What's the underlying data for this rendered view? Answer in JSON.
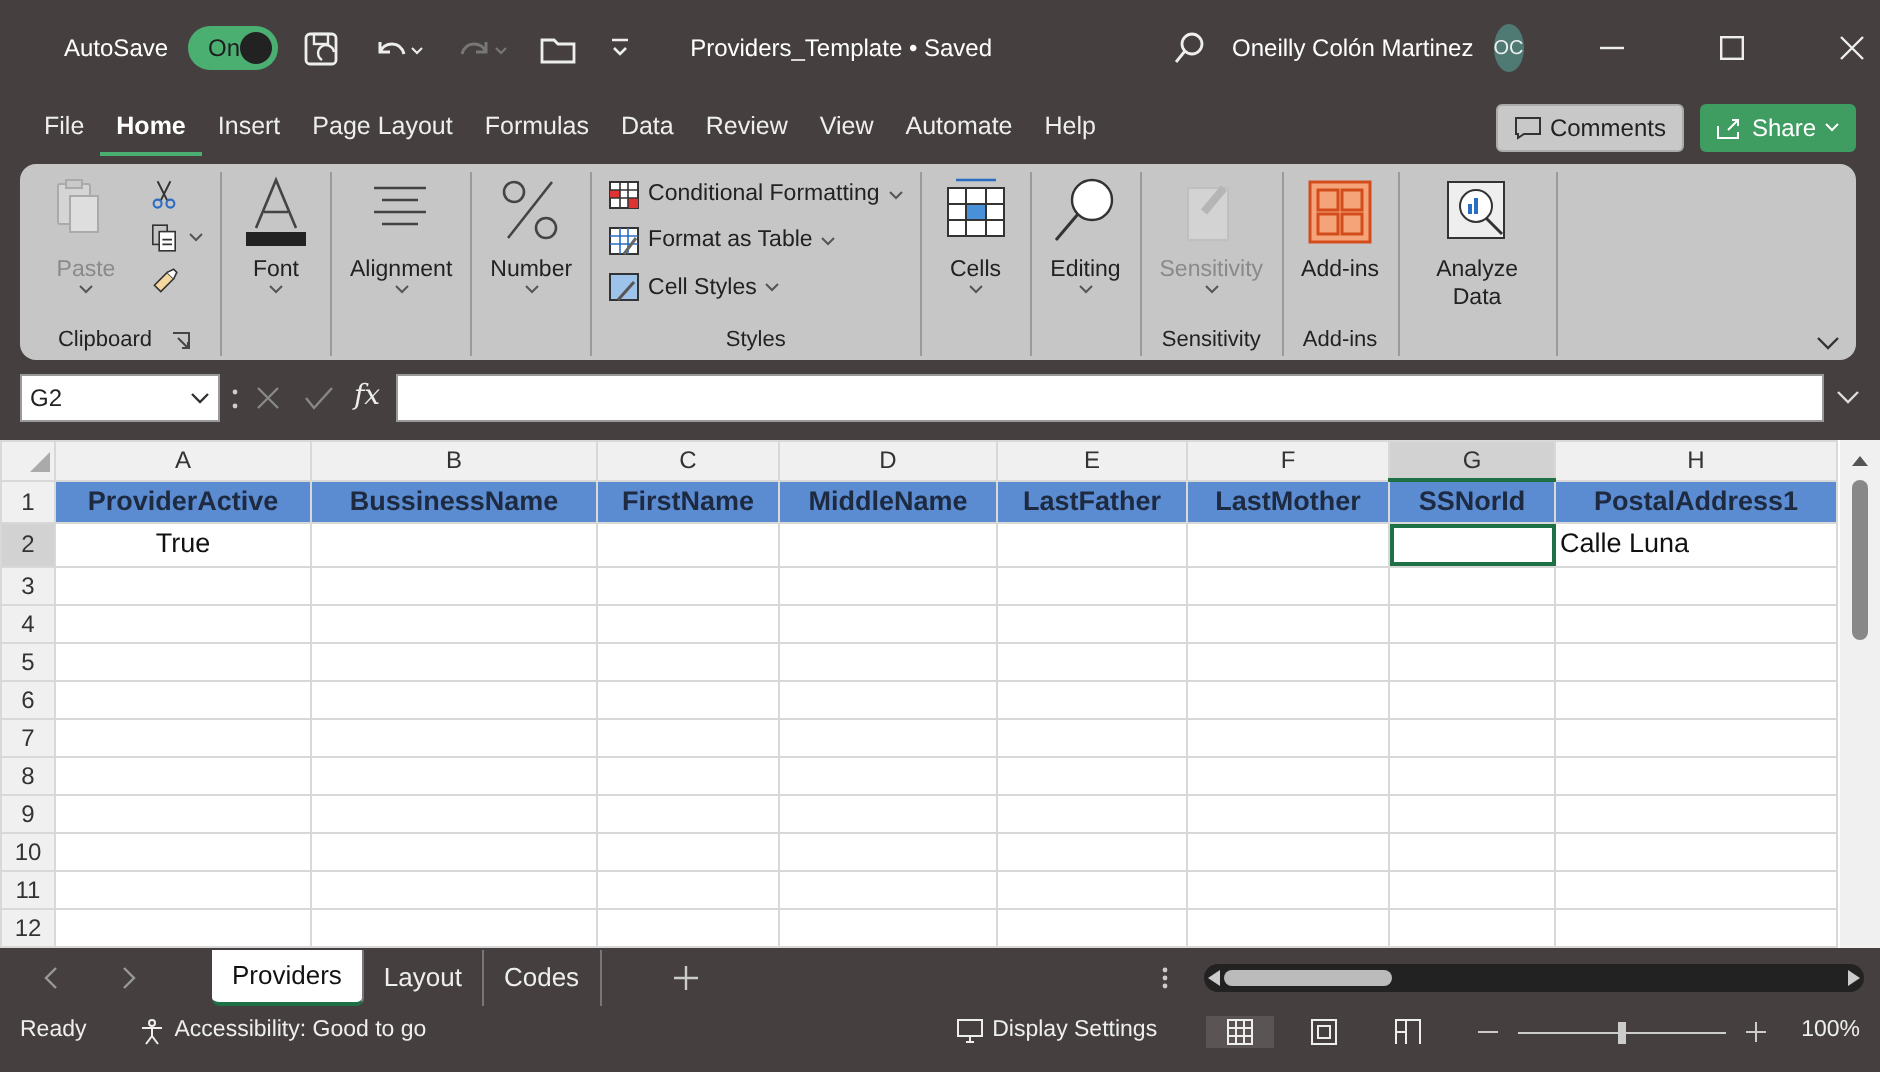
{
  "title_bar": {
    "autosave_label": "AutoSave",
    "autosave_toggle": {
      "text": "On",
      "on": true
    },
    "file_title": "Providers_Template • Saved",
    "user_name": "Oneilly Colón Martinez",
    "user_initials": "OC"
  },
  "menu_tabs": [
    {
      "label": "File",
      "selected": false
    },
    {
      "label": "Home",
      "selected": true
    },
    {
      "label": "Insert",
      "selected": false
    },
    {
      "label": "Page Layout",
      "selected": false
    },
    {
      "label": "Formulas",
      "selected": false
    },
    {
      "label": "Data",
      "selected": false
    },
    {
      "label": "Review",
      "selected": false
    },
    {
      "label": "View",
      "selected": false
    },
    {
      "label": "Automate",
      "selected": false
    },
    {
      "label": "Help",
      "selected": false
    }
  ],
  "comments_button": "Comments",
  "share_button": "Share",
  "ribbon_groups": [
    {
      "label": "Clipboard",
      "launcher": true,
      "large": [
        {
          "kind": "paste",
          "label": "Paste",
          "disabled": true,
          "dropdown": true
        }
      ],
      "small": [
        {
          "kind": "cut",
          "disabled": false,
          "dropdown": false
        },
        {
          "kind": "copy",
          "disabled": false,
          "dropdown": true
        },
        {
          "kind": "brush",
          "disabled": false,
          "dropdown": false
        }
      ]
    },
    {
      "large": [
        {
          "kind": "font",
          "label": "Font",
          "disabled": false,
          "dropdown": true
        }
      ]
    },
    {
      "large": [
        {
          "kind": "align",
          "label": "Alignment",
          "disabled": false,
          "dropdown": true
        }
      ]
    },
    {
      "large": [
        {
          "kind": "percent",
          "label": "Number",
          "disabled": false,
          "dropdown": true
        }
      ]
    },
    {
      "label": "Styles",
      "small": [
        {
          "kind": "condfmt",
          "label": "Conditional Formatting",
          "disabled": false,
          "dropdown": true
        },
        {
          "kind": "table",
          "label": "Format as Table",
          "disabled": false,
          "dropdown": true
        },
        {
          "kind": "cellstyle",
          "label": "Cell Styles",
          "disabled": false,
          "dropdown": true
        }
      ]
    },
    {
      "large": [
        {
          "kind": "cells",
          "label": "Cells",
          "disabled": false,
          "dropdown": true
        }
      ]
    },
    {
      "large": [
        {
          "kind": "search",
          "label": "Editing",
          "disabled": false,
          "dropdown": true
        }
      ]
    },
    {
      "label": "Sensitivity",
      "large": [
        {
          "kind": "sensitivity",
          "label": "Sensitivity",
          "disabled": true,
          "dropdown": true
        }
      ]
    },
    {
      "label": "Add-ins",
      "large": [
        {
          "kind": "addins",
          "label": "Add-ins",
          "disabled": false,
          "dropdown": false
        }
      ]
    },
    {
      "large": [
        {
          "kind": "analyze",
          "label": "Analyze Data",
          "disabled": false,
          "dropdown": false
        }
      ]
    }
  ],
  "formula_bar": {
    "name_box": "G2",
    "fx_label": "fx"
  },
  "columns": [
    {
      "letter": "A",
      "selected": false
    },
    {
      "letter": "B",
      "selected": false
    },
    {
      "letter": "C",
      "selected": false
    },
    {
      "letter": "D",
      "selected": false
    },
    {
      "letter": "E",
      "selected": false
    },
    {
      "letter": "F",
      "selected": false
    },
    {
      "letter": "G",
      "selected": true
    },
    {
      "letter": "H",
      "selected": false
    }
  ],
  "rows": [
    {
      "number": "1",
      "kind": "header",
      "selected": false,
      "cells": {
        "column_1": {
          "text": "ProviderActive"
        },
        "column_2": {
          "text": "BussinessName"
        },
        "column_3": {
          "text": "FirstName"
        },
        "column_4": {
          "text": "MiddleName"
        },
        "column_5": {
          "text": "LastFather"
        },
        "column_6": {
          "text": "LastMother"
        },
        "column_7": {
          "text": "SSNorId"
        },
        "column_8": {
          "text": "PostalAddress1"
        }
      }
    },
    {
      "number": "2",
      "kind": "data",
      "selected": true,
      "cells": {
        "column_1": {
          "text": "True",
          "kind": "boolean"
        },
        "column_8": {
          "text": "Calle Luna"
        }
      }
    },
    {
      "number": "3",
      "kind": "data",
      "selected": false
    },
    {
      "number": "4",
      "kind": "data",
      "selected": false
    },
    {
      "number": "5",
      "kind": "data",
      "selected": false
    },
    {
      "number": "6",
      "kind": "data",
      "selected": false
    },
    {
      "number": "7",
      "kind": "data",
      "selected": false
    },
    {
      "number": "8",
      "kind": "data",
      "selected": false
    },
    {
      "number": "9",
      "kind": "data",
      "selected": false
    },
    {
      "number": "10",
      "kind": "data",
      "selected": false
    },
    {
      "number": "11",
      "kind": "data",
      "selected": false
    },
    {
      "number": "12",
      "kind": "data",
      "selected": false
    }
  ],
  "sheet_tabs": [
    {
      "label": "Providers",
      "selected": true
    },
    {
      "label": "Layout",
      "selected": false
    },
    {
      "label": "Codes",
      "selected": false
    }
  ],
  "status_bar": {
    "ready": "Ready",
    "accessibility": "Accessibility: Good to go",
    "display_settings": "Display Settings",
    "views": [
      {
        "kind": "normal",
        "selected": true
      },
      {
        "kind": "page-layout",
        "selected": false
      },
      {
        "kind": "page-break",
        "selected": false
      }
    ],
    "zoom": {
      "level": 0.5,
      "text": "100%"
    }
  }
}
